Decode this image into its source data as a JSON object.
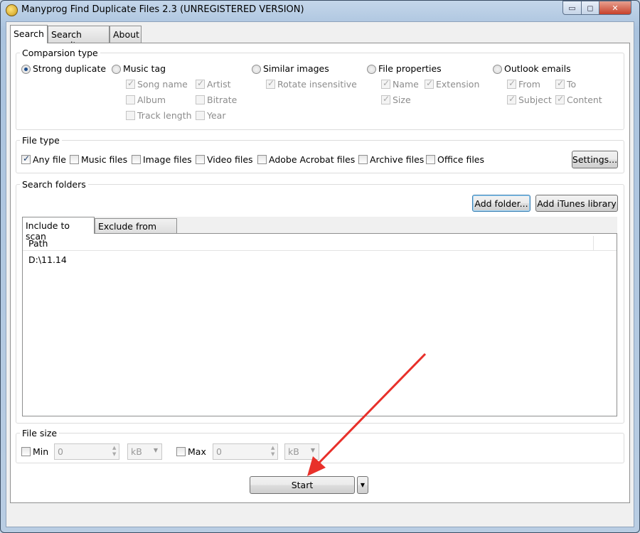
{
  "window": {
    "title": "Manyprog Find Duplicate Files 2.3 (UNREGISTERED VERSION)",
    "minimize": "▭",
    "maximize": "◻",
    "close": "✕"
  },
  "tabs": [
    {
      "label": "Search",
      "active": true
    },
    {
      "label": "Search result"
    },
    {
      "label": "About"
    }
  ],
  "comparison": {
    "title": "Comparsion type",
    "strong": "Strong duplicate",
    "music": "Music tag",
    "song_name": "Song name",
    "artist": "Artist",
    "album": "Album",
    "bitrate": "Bitrate",
    "track_length": "Track length",
    "year": "Year",
    "images": "Similar images",
    "rotate": "Rotate insensitive",
    "fileprops": "File properties",
    "name": "Name",
    "extension": "Extension",
    "size": "Size",
    "outlook": "Outlook emails",
    "from": "From",
    "to": "To",
    "subject": "Subject",
    "content": "Content"
  },
  "filetype": {
    "title": "File type",
    "items": [
      "Any file",
      "Music files",
      "Image files",
      "Video files",
      "Adobe Acrobat files",
      "Archive files",
      "Office files"
    ],
    "settings": "Settings..."
  },
  "folders": {
    "title": "Search folders",
    "add_folder": "Add folder...",
    "add_itunes": "Add iTunes library",
    "tabs": [
      "Include to scan",
      "Exclude from scan"
    ],
    "column": "Path",
    "rows": [
      "D:\\11.14"
    ]
  },
  "filesize": {
    "title": "File size",
    "min": "Min",
    "max": "Max",
    "min_value": "0",
    "max_value": "0",
    "min_unit": "kB",
    "max_unit": "kB"
  },
  "start": "Start",
  "colors": {
    "annotation_arrow": "#e8302a"
  }
}
